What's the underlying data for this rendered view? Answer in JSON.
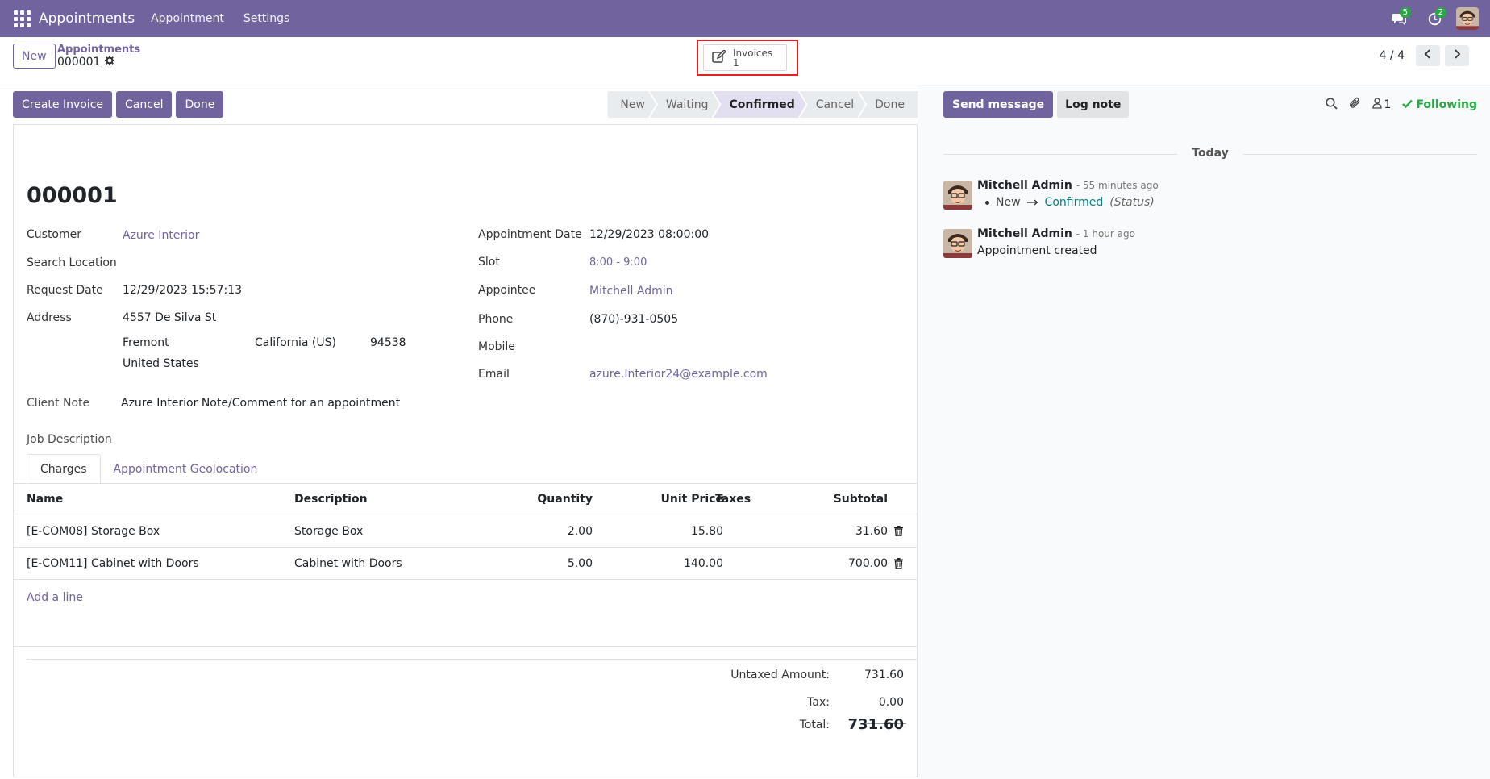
{
  "navbar": {
    "brand": "Appointments",
    "menus": [
      "Appointment",
      "Settings"
    ],
    "messages_badge": "5",
    "activities_badge": "2"
  },
  "control_panel": {
    "new_label": "New",
    "breadcrumb_parent": "Appointments",
    "breadcrumb_current": "000001",
    "smart_button": {
      "label": "Invoices",
      "count": "1"
    },
    "pager_value": "4 / 4"
  },
  "statusbar": {
    "actions": [
      "Create Invoice",
      "Cancel",
      "Done"
    ],
    "steps": [
      "New",
      "Waiting",
      "Confirmed",
      "Cancel",
      "Done"
    ],
    "active_step": "Confirmed"
  },
  "record": {
    "title": "000001",
    "customer_label": "Customer",
    "customer": "Azure Interior",
    "search_location_label": "Search Location",
    "request_date_label": "Request Date",
    "request_date": "12/29/2023 15:57:13",
    "address_label": "Address",
    "street": "4557 De Silva St",
    "city": "Fremont",
    "state": "California (US)",
    "zip": "94538",
    "country": "United States",
    "client_note_label": "Client Note",
    "client_note": "Azure Interior Note/Comment for an appointment",
    "job_description_label": "Job Description",
    "appointment_date_label": "Appointment Date",
    "appointment_date": "12/29/2023 08:00:00",
    "slot_label": "Slot",
    "slot": "8:00 - 9:00",
    "appointee_label": "Appointee",
    "appointee": "Mitchell Admin",
    "phone_label": "Phone",
    "phone": "(870)-931-0505",
    "mobile_label": "Mobile",
    "email_label": "Email",
    "email": "azure.Interior24@example.com"
  },
  "tabs": [
    "Charges",
    "Appointment Geolocation"
  ],
  "charges": {
    "columns": [
      "Name",
      "Description",
      "Quantity",
      "Unit Price",
      "Taxes",
      "Subtotal"
    ],
    "rows": [
      {
        "name": "[E-COM08] Storage Box",
        "description": "Storage Box",
        "quantity": "2.00",
        "unit_price": "15.80",
        "taxes": "",
        "subtotal": "31.60"
      },
      {
        "name": "[E-COM11] Cabinet with Doors",
        "description": "Cabinet with Doors",
        "quantity": "5.00",
        "unit_price": "140.00",
        "taxes": "",
        "subtotal": "700.00"
      }
    ],
    "add_line": "Add a line"
  },
  "totals": {
    "untaxed_label": "Untaxed Amount:",
    "untaxed": "731.60",
    "tax_label": "Tax:",
    "tax": "0.00",
    "total_label": "Total:",
    "total": "731.60"
  },
  "chatter": {
    "send_message": "Send message",
    "log_note": "Log note",
    "followers_count": "1",
    "following": "Following",
    "date_separator": "Today",
    "messages": [
      {
        "author": "Mitchell Admin",
        "date": "- 55 minutes ago",
        "tracking_old": "New",
        "tracking_new": "Confirmed",
        "tracking_field": "(Status)"
      },
      {
        "author": "Mitchell Admin",
        "date": "- 1 hour ago",
        "body": "Appointment created"
      }
    ]
  }
}
